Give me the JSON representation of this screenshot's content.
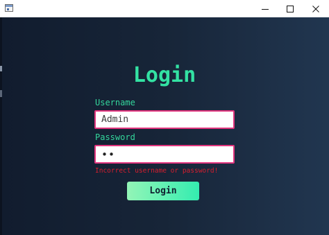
{
  "window": {
    "controls": {
      "minimize_icon": "minimize-icon",
      "maximize_icon": "maximize-icon",
      "close_icon": "close-icon"
    }
  },
  "form": {
    "title": "Login",
    "username_label": "Username",
    "username_value": "Admin",
    "password_label": "Password",
    "password_value": "••",
    "error_message": "Incorrect username or password!",
    "submit_label": "Login"
  },
  "colors": {
    "accent": "#33e2a3",
    "input_border": "#e2357e",
    "error": "#d81e2e",
    "button_gradient_start": "#93f5b7",
    "button_gradient_end": "#34edb0"
  }
}
